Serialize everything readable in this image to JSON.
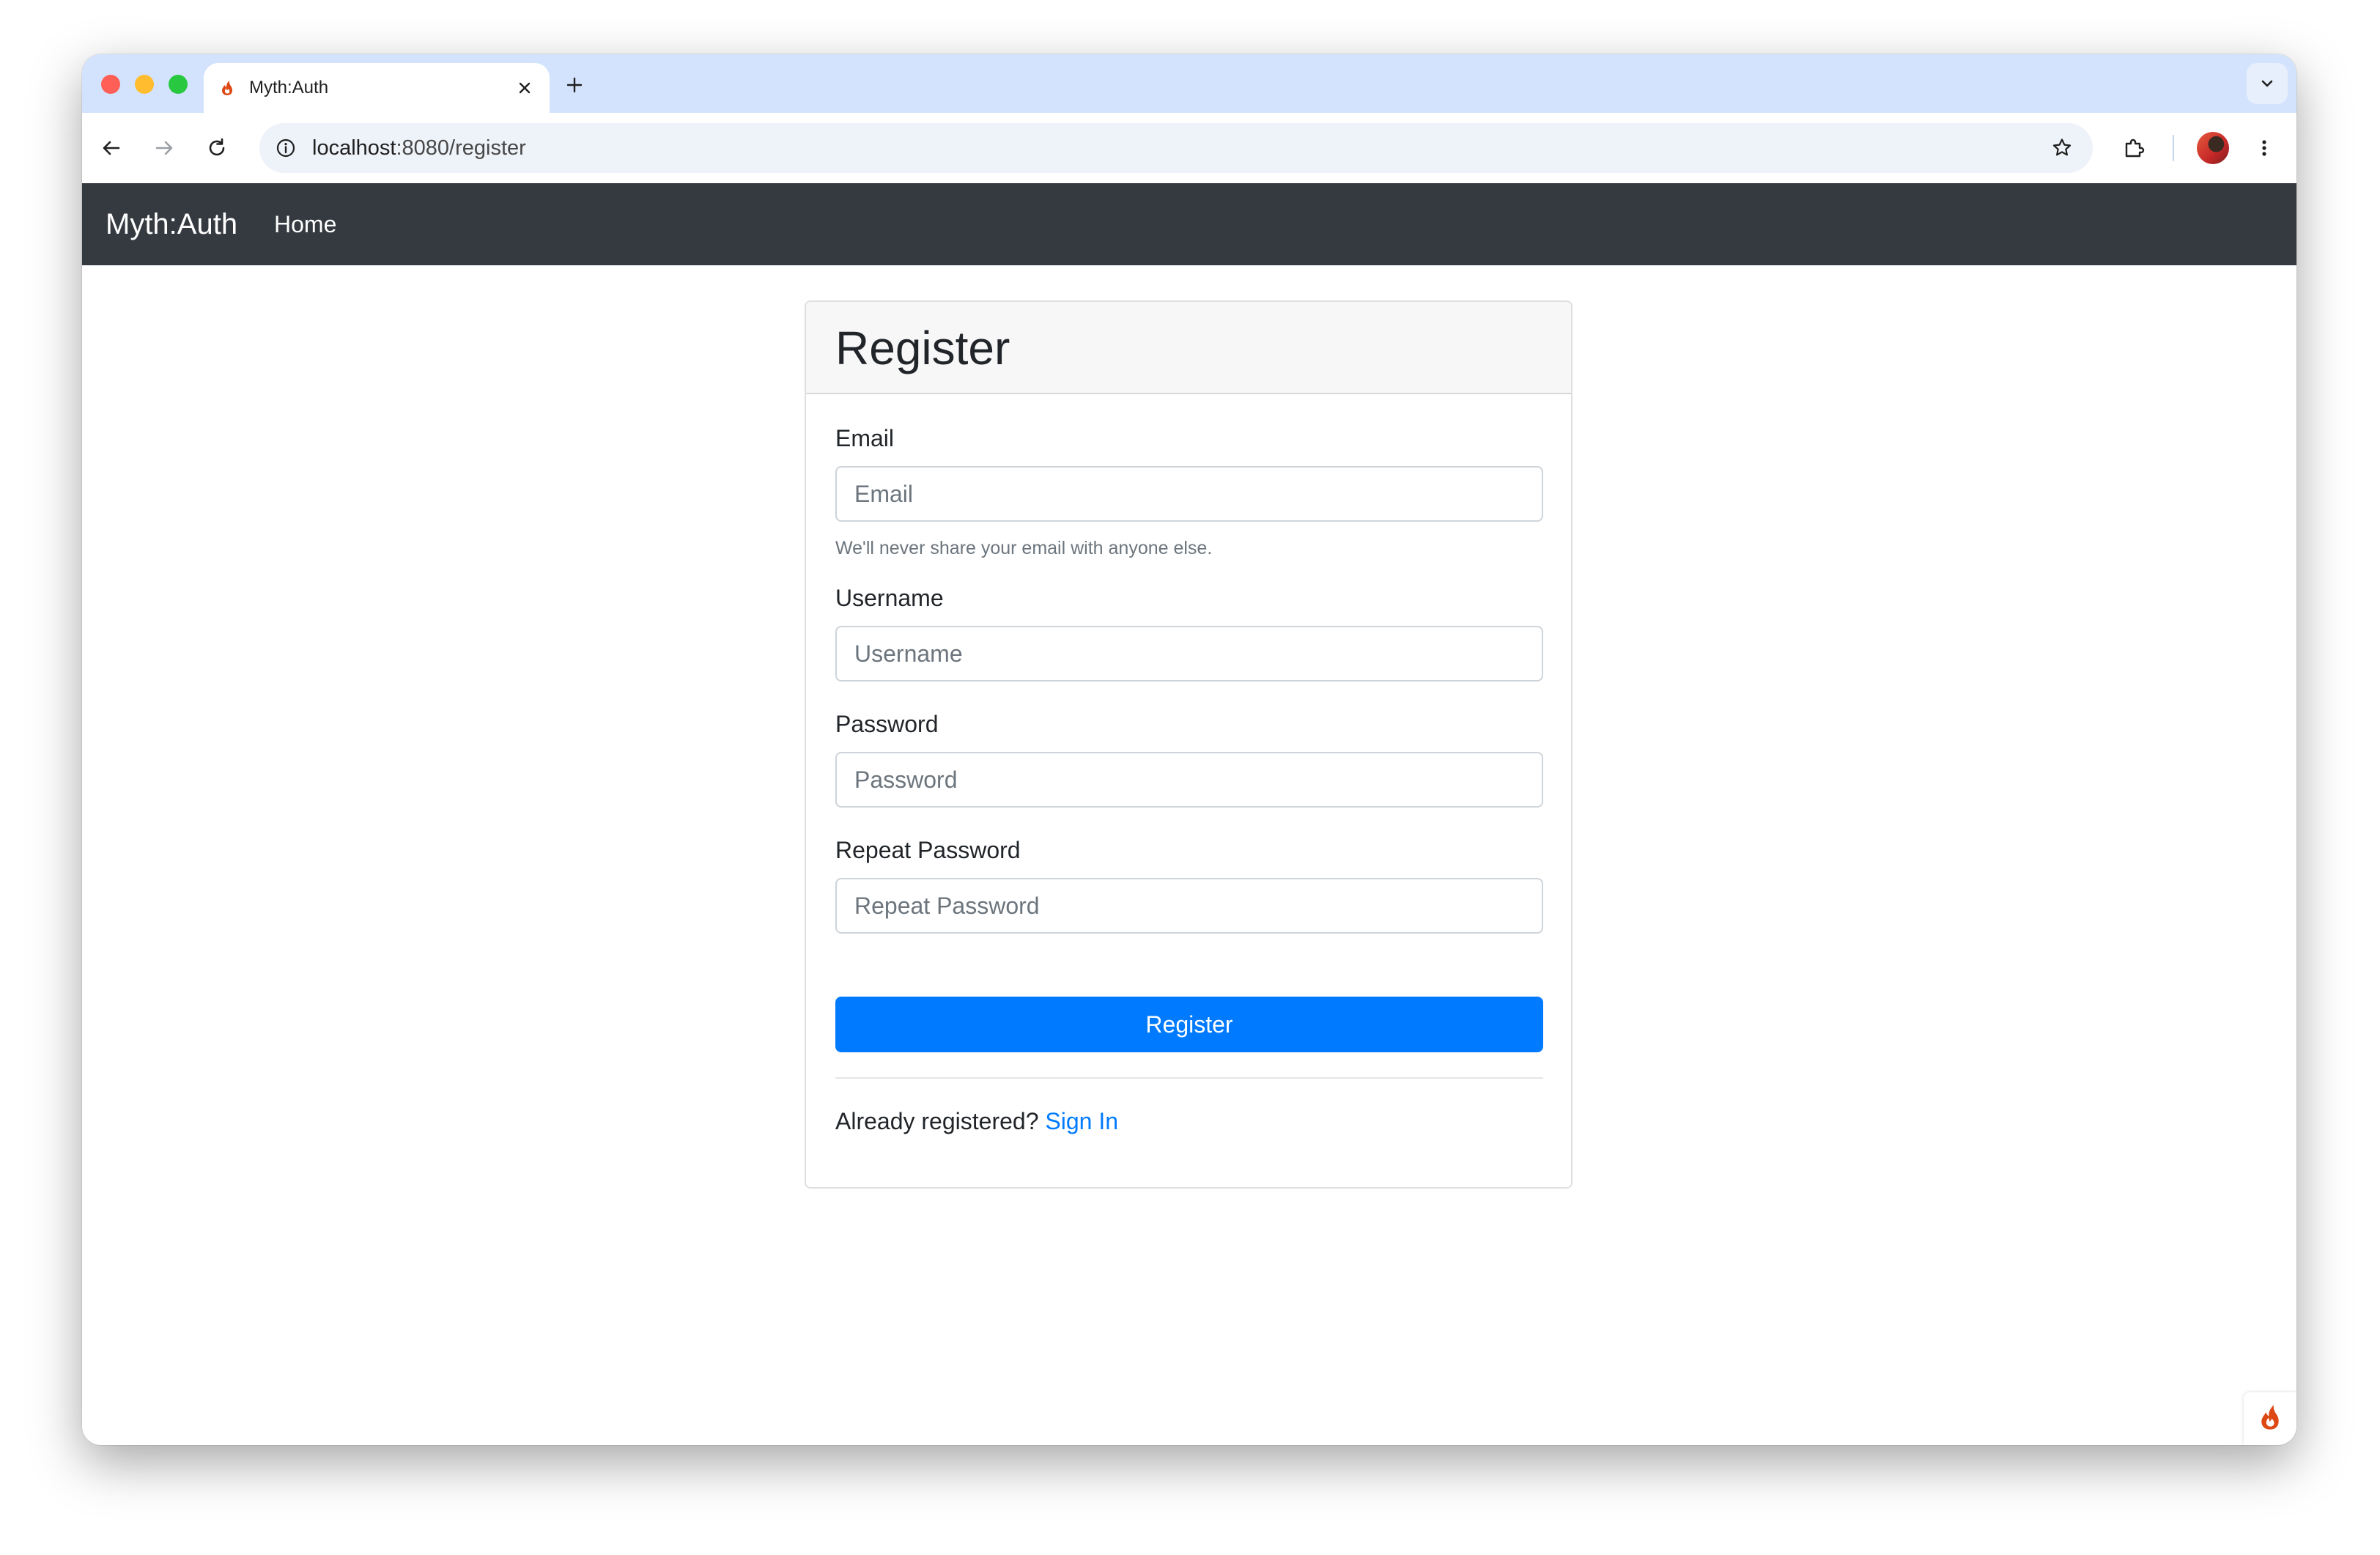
{
  "browser": {
    "tab_title": "Myth:Auth",
    "url_host": "localhost",
    "url_path": ":8080/register"
  },
  "navbar": {
    "brand": "Myth:Auth",
    "home_link": "Home"
  },
  "register_form": {
    "title": "Register",
    "email_label": "Email",
    "email_placeholder": "Email",
    "email_help": "We'll never share your email with anyone else.",
    "username_label": "Username",
    "username_placeholder": "Username",
    "password_label": "Password",
    "password_placeholder": "Password",
    "repeat_password_label": "Repeat Password",
    "repeat_password_placeholder": "Repeat Password",
    "submit_label": "Register",
    "already_registered_text": "Already registered?",
    "sign_in_link": "Sign In"
  },
  "colors": {
    "tab_strip": "#d3e3fd",
    "navbar": "#343a40",
    "primary": "#007bff",
    "codeigniter_flame": "#dd4814"
  }
}
